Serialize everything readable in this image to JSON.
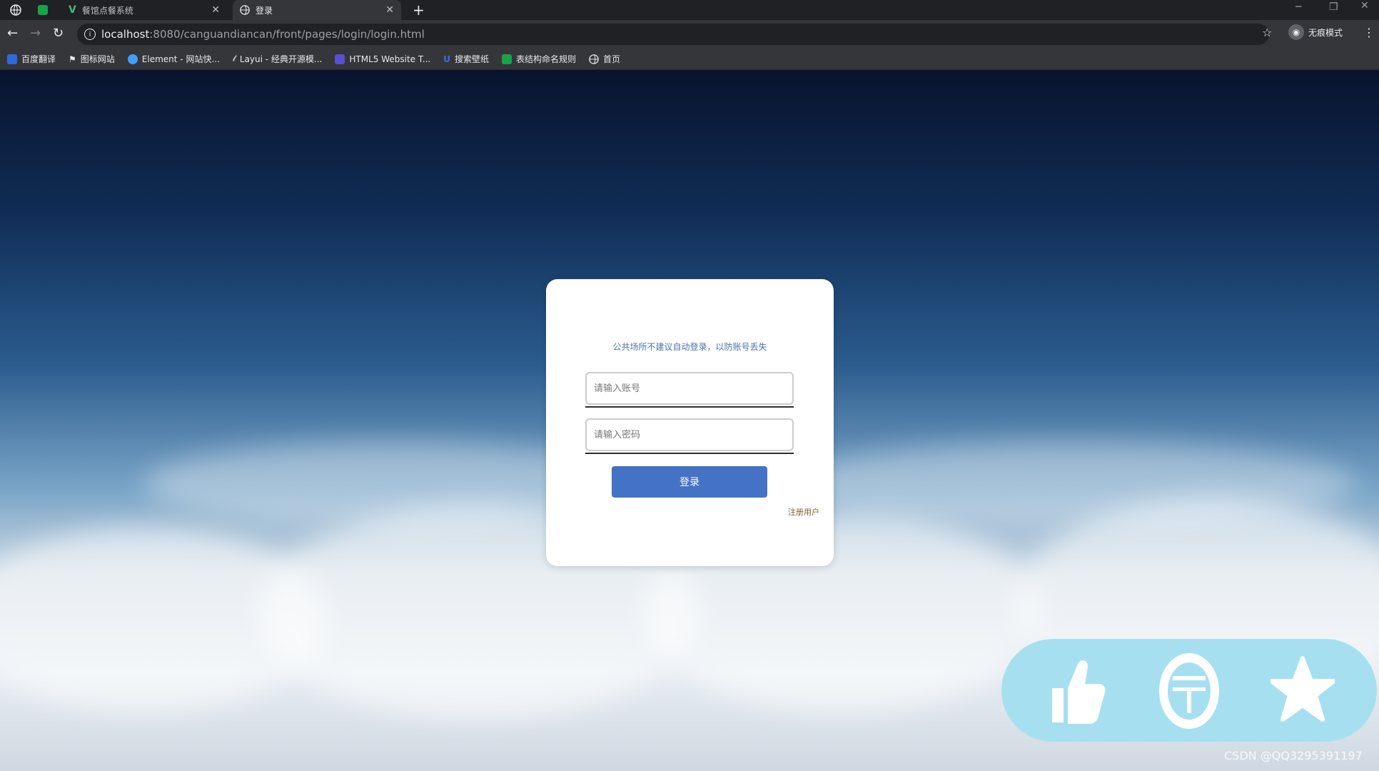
{
  "browser": {
    "tabs": [
      {
        "title": "餐馆点餐系统",
        "active": false
      },
      {
        "title": "登录",
        "active": true
      }
    ],
    "url_host": "localhost",
    "url_path": ":8080/canguandiancan/front/pages/login/login.html",
    "profile_label": "无痕模式",
    "bookmarks": [
      {
        "label": "百度翻译",
        "color": "#2e6bd8"
      },
      {
        "label": "图标网站",
        "color": "#ffffff"
      },
      {
        "label": "Element - 网站快...",
        "color": "#409eff"
      },
      {
        "label": "Layui - 经典开源模...",
        "color": "#cfd3d8"
      },
      {
        "label": "HTML5 Website T...",
        "color": "#5b4fd1"
      },
      {
        "label": "搜索壁纸",
        "color": "#3b6cd9"
      },
      {
        "label": "表结构命名规则",
        "color": "#16a34a"
      },
      {
        "label": "首页",
        "color": "#e8eaed"
      }
    ]
  },
  "login": {
    "hint": "公共场所不建议自动登录，以防账号丢失",
    "account_placeholder": "请输入账号",
    "password_placeholder": "请输入密码",
    "login_button": "登录",
    "register_link": "注册用户"
  },
  "watermark": "CSDN @QQ3295391197",
  "colors": {
    "accent": "#4472c4",
    "card": "#ffffff",
    "fab_panel": "#a6e0f0"
  },
  "fab_icons": [
    "thumbs-up-icon",
    "coin-icon",
    "star-icon"
  ]
}
